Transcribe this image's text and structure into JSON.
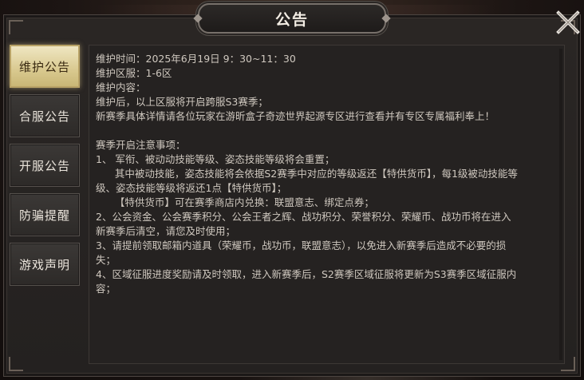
{
  "title": "公告",
  "close_icon": "close-icon",
  "sidebar": {
    "items": [
      {
        "label": "维护公告",
        "active": true
      },
      {
        "label": "合服公告",
        "active": false
      },
      {
        "label": "开服公告",
        "active": false
      },
      {
        "label": "防骗提醒",
        "active": false
      },
      {
        "label": "游戏声明",
        "active": false
      }
    ]
  },
  "content": {
    "lines": [
      "维护时间：2025年6月19日 9：30~11：30",
      "维护区服：1-6区",
      "维护内容：",
      "维护后，以上区服将开启跨服S3赛季；",
      "新赛季具体详情请各位玩家在游昕盒子奇迹世界起源专区进行查看并有专区专属福利奉上！",
      "",
      "赛季开启注意事项：",
      "1、 军衔、被动动技能等级、姿态技能等级将会重置；",
      "      其中被动技能，姿态技能将会依据S2赛季中对应的等级返还【特供货币】，每1级被动技能等",
      "级、姿态技能等级将返还1点【特供货币】；",
      "      【特供货币】可在赛季商店内兑换：联盟意志、绑定点券；",
      "2、公会资金、公会赛季积分、公会王者之辉、战功积分、荣誉积分、荣耀币、战功币将在进入",
      "新赛季后清空，请您及时使用；",
      "3、请提前领取邮箱内道具（荣耀币，战功币，联盟意志），以免进入新赛季后造成不必要的损",
      "失；",
      "4、区域征服进度奖励请及时领取，进入新赛季后，S2赛季区域征服将更新为S3赛季区域征服内",
      "容；"
    ]
  },
  "colors": {
    "active_tab": "#e2d49c",
    "body_text": "#cfc8bf",
    "panel_bg": "#252221"
  }
}
